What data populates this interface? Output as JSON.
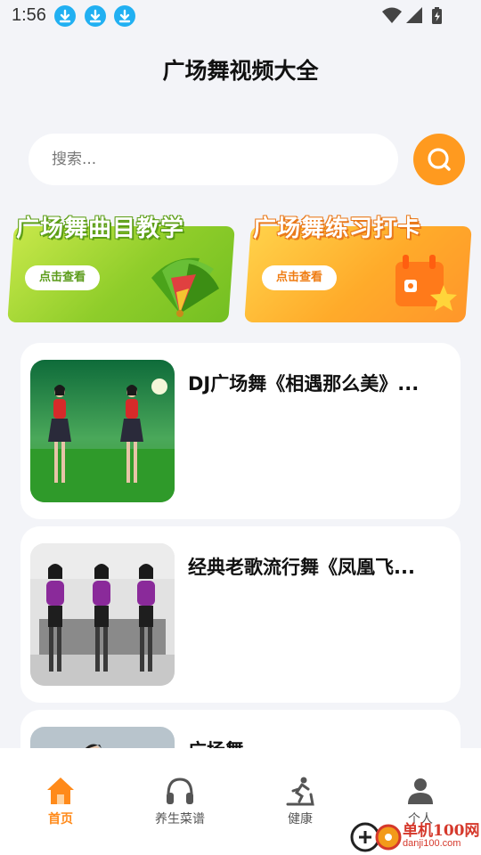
{
  "status_bar": {
    "time": "1:56",
    "download_icons": [
      "download-icon",
      "download-icon",
      "download-icon"
    ],
    "system_icons": [
      "wifi-icon",
      "signal-icon",
      "battery-icon"
    ]
  },
  "header": {
    "title": "广场舞视频大全"
  },
  "search": {
    "placeholder": "搜索...",
    "value": "",
    "button_icon": "search-icon"
  },
  "banners": [
    {
      "title": "广场舞曲目教学",
      "cta": "点击查看",
      "icon": "fan-icon",
      "color": "#8fcd2a"
    },
    {
      "title": "广场舞练习打卡",
      "cta": "点击查看",
      "icon": "calendar-star-icon",
      "color": "#ffab2a"
    }
  ],
  "videos": [
    {
      "title": "DJ广场舞《相遇那么美》..."
    },
    {
      "title": "经典老歌流行舞《凤凰飞..."
    },
    {
      "title": "广场舞"
    }
  ],
  "bottom_nav": [
    {
      "label": "首页",
      "icon": "home-icon",
      "active": true
    },
    {
      "label": "养生菜谱",
      "icon": "headphones-icon",
      "active": false
    },
    {
      "label": "健康",
      "icon": "treadmill-icon",
      "active": false
    },
    {
      "label": "个人",
      "icon": "user-icon",
      "active": false
    }
  ],
  "watermark": {
    "text": "单机100网",
    "domain": "danji100.com"
  },
  "colors": {
    "accent": "#ff9a1f",
    "download_badge": "#21b0f2",
    "background": "#f3f4f8"
  }
}
